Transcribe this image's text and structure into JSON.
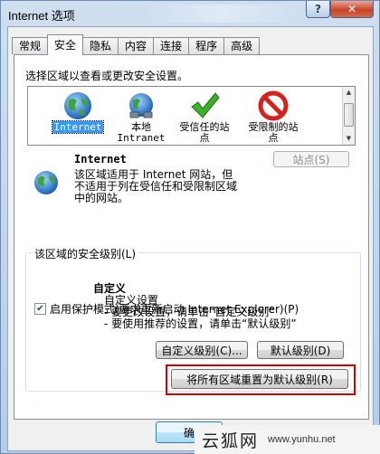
{
  "window": {
    "title": "Internet 选项",
    "help_label": "?",
    "close_label": "✕"
  },
  "tabs": [
    {
      "label": "常规",
      "active": false
    },
    {
      "label": "安全",
      "active": true
    },
    {
      "label": "隐私",
      "active": false
    },
    {
      "label": "内容",
      "active": false
    },
    {
      "label": "连接",
      "active": false
    },
    {
      "label": "程序",
      "active": false
    },
    {
      "label": "高级",
      "active": false
    }
  ],
  "security": {
    "intro": "选择区域以查看或更改安全设置。",
    "zones": [
      {
        "label": "Internet",
        "icon": "globe-icon",
        "selected": true
      },
      {
        "label_line1": "本地",
        "label_line2": "Intranet",
        "icon": "intranet-globe-icon",
        "selected": false
      },
      {
        "label_line1": "受信任的站",
        "label_line2": "点",
        "icon": "check-icon",
        "selected": false
      },
      {
        "label_line1": "受限制的站",
        "label_line2": "点",
        "icon": "restricted-icon",
        "selected": false
      }
    ],
    "zone_detail": {
      "name": "Internet",
      "desc_line1": "该区域适用于 Internet 网站，但",
      "desc_line2": "不适用于列在受信任和受限制区域",
      "desc_line3": "中的网站。",
      "sites_button": "站点(S)"
    },
    "level_group": {
      "title": "该区域的安全级别(L)",
      "level_name": "自定义",
      "desc_line1": "自定义设置",
      "desc_line2": "- 要更改设置，请单击“自定义级别”",
      "desc_line3": "- 要使用推荐的设置，请单击“默认级别”"
    },
    "protected_mode": {
      "label": "启用保护模式(要求重新启动 Internet Explorer)(P)",
      "checked": true
    },
    "custom_level_button": "自定义级别(C)...",
    "default_level_button": "默认级别(D)",
    "reset_all_button": "将所有区域重置为默认级别(R)"
  },
  "footer": {
    "ok_label": "确"
  },
  "watermark": {
    "text_cn": "云狐网",
    "url": "www.yunhu.net"
  },
  "colors": {
    "highlight": "#d40000",
    "selection": "#3399ff",
    "check": "#3fae29",
    "restricted": "#d4231e"
  }
}
